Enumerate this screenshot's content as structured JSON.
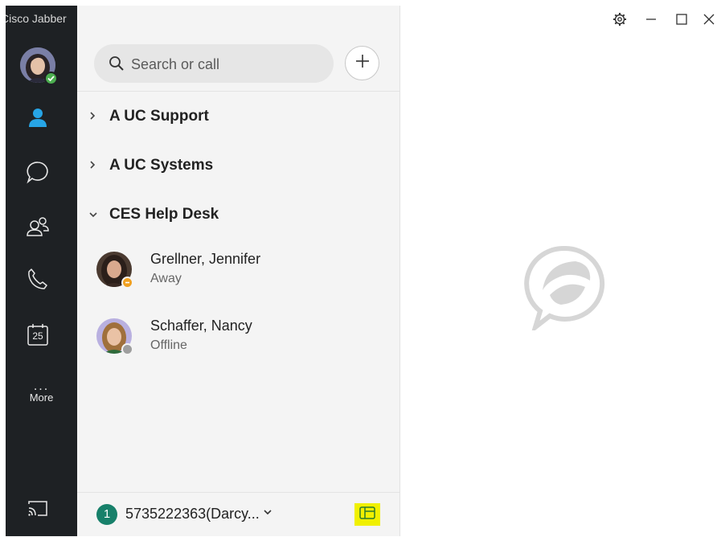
{
  "app": {
    "title": "Cisco Jabber"
  },
  "rail": {
    "items": [
      {
        "icon": "contacts-icon",
        "active": true
      },
      {
        "icon": "chat-icon"
      },
      {
        "icon": "meetings-people-icon"
      },
      {
        "icon": "phone-icon"
      },
      {
        "icon": "calendar-icon",
        "day": "25"
      }
    ],
    "more_label": "More",
    "more_dots": "...",
    "bottom_icon": "cast-icon"
  },
  "search": {
    "placeholder": "Search or call"
  },
  "groups": [
    {
      "label": "A UC Support",
      "expanded": false,
      "chevron": "›"
    },
    {
      "label": "A UC Systems",
      "expanded": false,
      "chevron": "›"
    },
    {
      "label": "CES Help Desk",
      "expanded": true,
      "chevron": "ˇ"
    }
  ],
  "contacts": [
    {
      "name": "Grellner, Jennifer",
      "status": "Away",
      "presence_color": "#f0a020"
    },
    {
      "name": "Schaffer, Nancy",
      "status": "Offline",
      "presence_color": "#9e9e9e"
    }
  ],
  "footer": {
    "badge": "1",
    "line": "5735222363(Darcy...",
    "chevron": "˅"
  },
  "window": {
    "settings_icon": "gear-icon",
    "minimize": "minimize-icon",
    "maximize": "maximize-icon",
    "close": "close-icon"
  },
  "colors": {
    "rail_bg": "#1e2124",
    "accent": "#27a5e6",
    "online": "#4caf50",
    "away": "#f0a020",
    "offline": "#9e9e9e",
    "badge": "#17806a",
    "highlight": "#f0f000"
  }
}
